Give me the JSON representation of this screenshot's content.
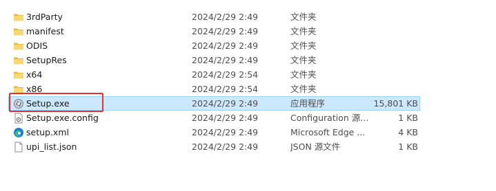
{
  "files": [
    {
      "name": "3rdParty",
      "date": "2024/2/29 2:49",
      "type": "文件夹",
      "size": "",
      "icon": "folder-icon"
    },
    {
      "name": "manifest",
      "date": "2024/2/29 2:49",
      "type": "文件夹",
      "size": "",
      "icon": "folder-icon"
    },
    {
      "name": "ODIS",
      "date": "2024/2/29 2:49",
      "type": "文件夹",
      "size": "",
      "icon": "folder-icon"
    },
    {
      "name": "SetupRes",
      "date": "2024/2/29 2:49",
      "type": "文件夹",
      "size": "",
      "icon": "folder-icon"
    },
    {
      "name": "x64",
      "date": "2024/2/29 2:54",
      "type": "文件夹",
      "size": "",
      "icon": "folder-icon"
    },
    {
      "name": "x86",
      "date": "2024/2/29 2:54",
      "type": "文件夹",
      "size": "",
      "icon": "folder-icon"
    },
    {
      "name": "Setup.exe",
      "date": "2024/2/29 2:49",
      "type": "应用程序",
      "size": "15,801 KB",
      "icon": "setup-exe-icon",
      "selected": true
    },
    {
      "name": "Setup.exe.config",
      "date": "2024/2/29 2:49",
      "type": "Configuration 源...",
      "size": "1 KB",
      "icon": "config-file-icon"
    },
    {
      "name": "setup.xml",
      "date": "2024/2/29 2:49",
      "type": "Microsoft Edge ...",
      "size": "4 KB",
      "icon": "edge-icon"
    },
    {
      "name": "upi_list.json",
      "date": "2024/2/29 2:49",
      "type": "JSON 源文件",
      "size": "1 KB",
      "icon": "json-file-icon"
    }
  ],
  "colors": {
    "selection_bg": "#cce8ff",
    "selection_border": "#99d1ff",
    "highlight_box": "#e5302a",
    "folder": "#f8d775"
  }
}
